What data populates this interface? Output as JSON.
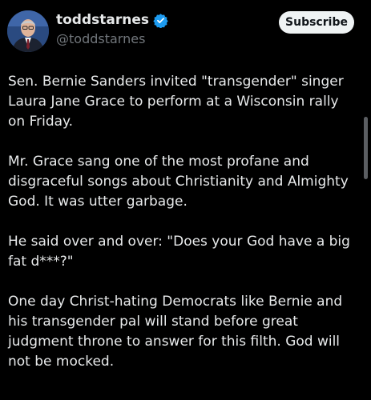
{
  "author": {
    "display_name": "toddstarnes",
    "handle": "@toddstarnes",
    "verified": true,
    "avatar_icon": "profile-photo"
  },
  "subscribe_label": "Subscribe",
  "post": {
    "paragraphs": [
      "Sen. Bernie Sanders invited \"transgender\" singer Laura Jane Grace to perform at a Wisconsin rally on Friday.",
      "Mr. Grace sang one of the most profane and disgraceful songs about Christianity and Almighty God. It was utter garbage.",
      "He said over and over: \"Does your God have a big fat d***?\"",
      "One day Christ-hating Democrats like Bernie and his transgender pal will stand before great judgment throne to answer for this filth. God will not be mocked."
    ]
  },
  "colors": {
    "background": "#000000",
    "text": "#e7e9ea",
    "muted": "#71767b",
    "verified": "#1d9bf0",
    "button_bg": "#eff3f4"
  }
}
